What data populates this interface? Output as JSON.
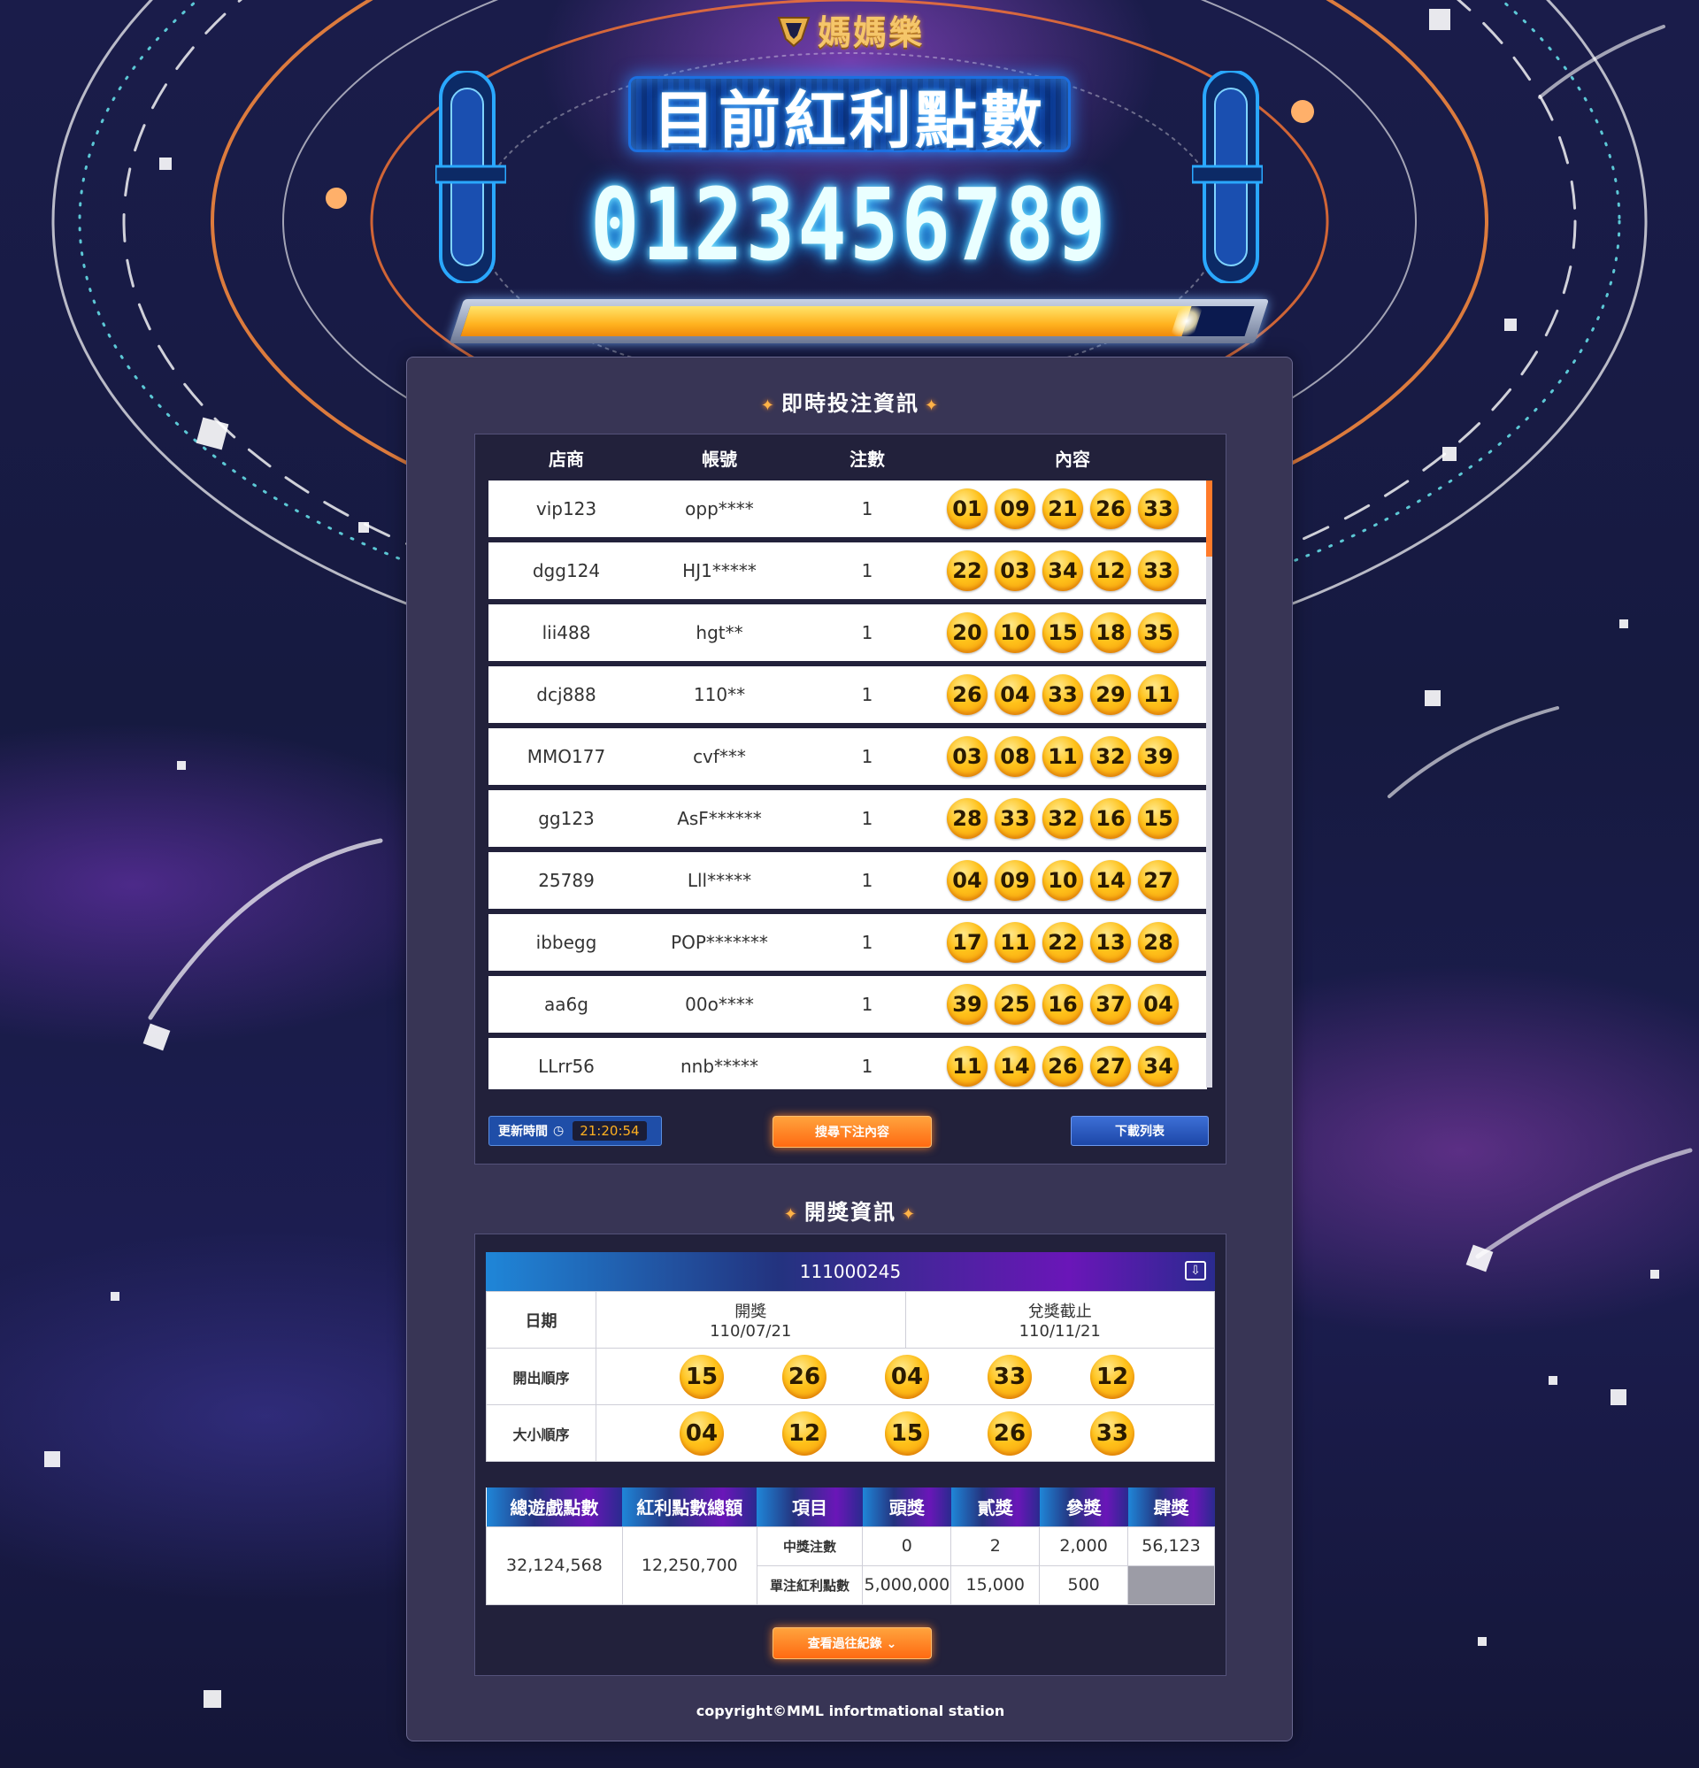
{
  "brand": {
    "name": "媽媽樂"
  },
  "header": {
    "title": "目前紅利點數",
    "points": "0123456789",
    "progress": 0.92
  },
  "bet_section": {
    "title": "即時投注資訊",
    "columns": [
      "店商",
      "帳號",
      "注數",
      "內容"
    ],
    "rows": [
      {
        "store": "vip123",
        "account": "opp****",
        "count": "1",
        "numbers": [
          "01",
          "09",
          "21",
          "26",
          "33"
        ]
      },
      {
        "store": "dgg124",
        "account": "HJ1*****",
        "count": "1",
        "numbers": [
          "22",
          "03",
          "34",
          "12",
          "33"
        ]
      },
      {
        "store": "lii488",
        "account": "hgt**",
        "count": "1",
        "numbers": [
          "20",
          "10",
          "15",
          "18",
          "35"
        ]
      },
      {
        "store": "dcj888",
        "account": "110**",
        "count": "1",
        "numbers": [
          "26",
          "04",
          "33",
          "29",
          "11"
        ]
      },
      {
        "store": "MMO177",
        "account": "cvf***",
        "count": "1",
        "numbers": [
          "03",
          "08",
          "11",
          "32",
          "39"
        ]
      },
      {
        "store": "gg123",
        "account": "AsF******",
        "count": "1",
        "numbers": [
          "28",
          "33",
          "32",
          "16",
          "15"
        ]
      },
      {
        "store": "25789",
        "account": "Lll*****",
        "count": "1",
        "numbers": [
          "04",
          "09",
          "10",
          "14",
          "27"
        ]
      },
      {
        "store": "ibbegg",
        "account": "POP*******",
        "count": "1",
        "numbers": [
          "17",
          "11",
          "22",
          "13",
          "28"
        ]
      },
      {
        "store": "aa6g",
        "account": "00o****",
        "count": "1",
        "numbers": [
          "39",
          "25",
          "16",
          "37",
          "04"
        ]
      },
      {
        "store": "LLrr56",
        "account": "nnb*****",
        "count": "1",
        "numbers": [
          "11",
          "14",
          "26",
          "27",
          "34"
        ]
      }
    ],
    "update_label": "更新時間",
    "update_time": "21:20:54",
    "search_button": "搜尋下注內容",
    "download_button": "下載列表"
  },
  "draw_section": {
    "title": "開獎資訊",
    "draw_id": "111000245",
    "date_label": "日期",
    "draw_date_label": "開獎",
    "draw_date": "110/07/21",
    "deadline_label": "兌獎截止",
    "deadline_date": "110/11/21",
    "order_label": "開出順序",
    "order_numbers": [
      "15",
      "26",
      "04",
      "33",
      "12"
    ],
    "size_label": "大小順序",
    "size_numbers": [
      "04",
      "12",
      "15",
      "26",
      "33"
    ]
  },
  "prize_table": {
    "headers": [
      "總遊戲點數",
      "紅利點數總額",
      "項目",
      "頭獎",
      "貳獎",
      "參獎",
      "肆獎"
    ],
    "total_points": "32,124,568",
    "bonus_total": "12,250,700",
    "row1_label": "中獎注數",
    "row1_values": [
      "0",
      "2",
      "2,000",
      "56,123"
    ],
    "row2_label": "單注紅利點數",
    "row2_values": [
      "5,000,000",
      "15,000",
      "500"
    ]
  },
  "history_button": "查看過往紀錄",
  "copyright": "copyright©MML infortmational station",
  "colors": {
    "accent_orange": "#ff7a1a",
    "ball_yellow": "#ffc21a",
    "panel": "#383555"
  }
}
